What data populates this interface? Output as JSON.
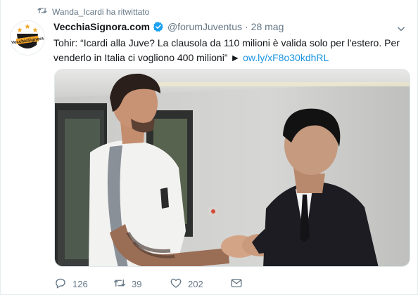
{
  "retweet_context": {
    "text": "Wanda_Icardi ha ritwittato",
    "icon": "retweet-icon"
  },
  "tweet": {
    "display_name": "VecchiaSignora.com",
    "verified": true,
    "handle": "@forumJuventus",
    "separator": "·",
    "time": "28 mag",
    "text": "Tohir: “Icardi alla Juve? La clausola da 110 milioni è valida solo per l'estero. Per venderlo in Italia ci vogliono 400 milioni” ► ",
    "link": "ow.ly/xF8o30kdhRL",
    "avatar": {
      "icon": "vecchiasignora-logo",
      "logo_text": "VecchiaSignora"
    },
    "media": {
      "icon": "photo"
    }
  },
  "actions": {
    "reply_count": "126",
    "retweet_count": "39",
    "like_count": "202"
  },
  "colors": {
    "link": "#1b95e0",
    "muted": "#657786",
    "verified": "#1da1f2",
    "text": "#14171a"
  }
}
